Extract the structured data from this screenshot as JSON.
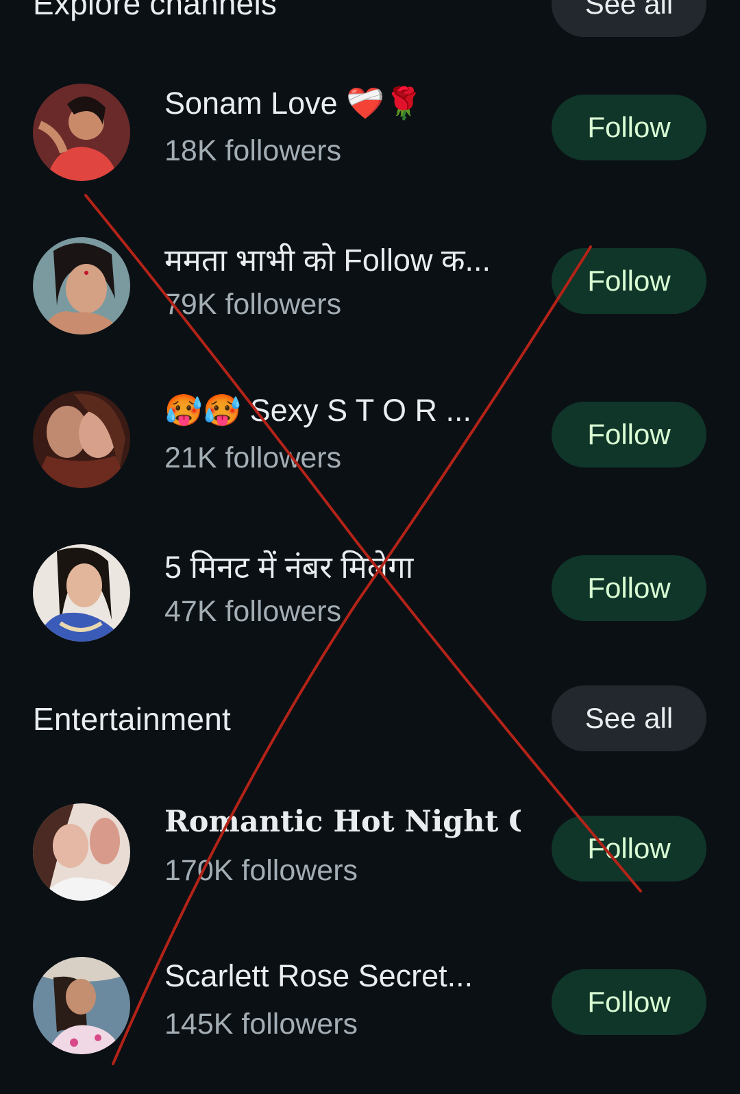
{
  "explore": {
    "title": "Explore channels",
    "see_all": "See all",
    "channels": [
      {
        "name": "Sonam Love ❤️‍🩹🌹",
        "followers": "18K followers",
        "follow": "Follow"
      },
      {
        "name": "ममता भाभी को Follow क...",
        "followers": "79K followers",
        "follow": "Follow"
      },
      {
        "name": "🥵🥵 Sexy S T O R ...",
        "followers": "21K followers",
        "follow": "Follow"
      },
      {
        "name": "5 मिनट में नंबर मिलेगा",
        "followers": "47K followers",
        "follow": "Follow"
      }
    ]
  },
  "entertainment": {
    "title": "Entertainment",
    "see_all": "See all",
    "channels": [
      {
        "name": "Romantic Hot Night C...",
        "followers": "170K followers",
        "follow": "Follow"
      },
      {
        "name": "Scarlett Rose Secret...",
        "followers": "145K followers",
        "follow": "Follow"
      }
    ]
  },
  "colors": {
    "background": "#0b1014",
    "follow_button_bg": "#103529",
    "follow_button_text": "#d9fdd3",
    "see_all_bg": "#22282d",
    "secondary_text": "#a3adb4",
    "cross_mark": "#b42318"
  }
}
